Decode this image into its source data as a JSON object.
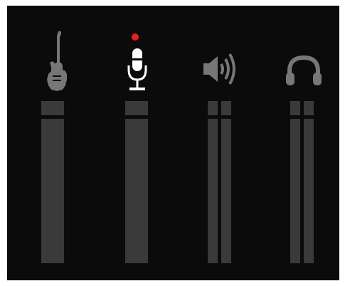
{
  "colors": {
    "background": "#0b0b0b",
    "meter": "#3a3a3a",
    "icon_inactive": "#777777",
    "icon_active": "#ffffff",
    "record_indicator": "#e8201c"
  },
  "channels": [
    {
      "id": "guitar",
      "icon": "guitar-icon",
      "active": false,
      "stereo": false,
      "armed": false
    },
    {
      "id": "microphone",
      "icon": "microphone-icon",
      "active": true,
      "stereo": false,
      "armed": true
    },
    {
      "id": "speaker",
      "icon": "speaker-icon",
      "active": false,
      "stereo": true,
      "armed": false
    },
    {
      "id": "headphones",
      "icon": "headphones-icon",
      "active": false,
      "stereo": true,
      "armed": false
    }
  ]
}
